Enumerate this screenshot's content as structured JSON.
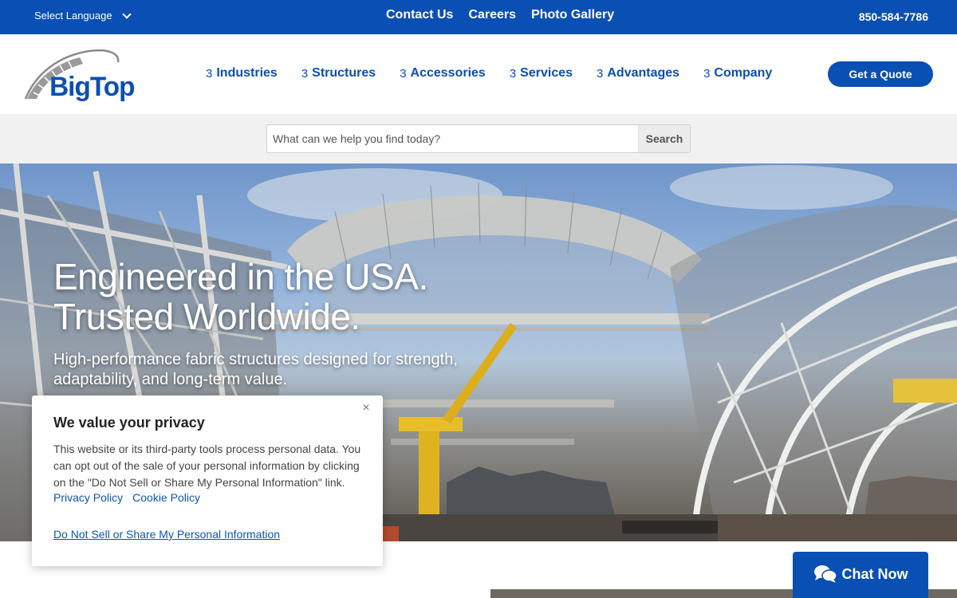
{
  "topbar": {
    "language_label": "Select Language",
    "links": [
      "Contact Us",
      "Careers",
      "Photo Gallery"
    ],
    "phone": "850-584-7786"
  },
  "header": {
    "logo_text": "BigTop",
    "nav_arrow": "3",
    "nav": [
      "Industries",
      "Structures",
      "Accessories",
      "Services",
      "Advantages",
      "Company"
    ],
    "quote_button": "Get a Quote"
  },
  "search": {
    "placeholder": "What can we help you find today?",
    "button": "Search"
  },
  "hero": {
    "title_line1": "Engineered in the USA.",
    "title_line2": "Trusted Worldwide.",
    "subtitle": "High-performance fabric structures designed for strength, adaptability, and long-term value."
  },
  "privacy": {
    "title": "We value your privacy",
    "body": "This website or its third-party tools process personal data. You can opt out of the sale of your personal information by clicking on the \"Do Not Sell or Share My Personal Information\" link.",
    "privacy_link": "Privacy Policy",
    "cookie_link": "Cookie Policy",
    "dns_link": "Do Not Sell or Share My Personal Information",
    "close_icon": "×"
  },
  "chat": {
    "label": "Chat Now"
  },
  "colors": {
    "brand_blue": "#0a4fb4",
    "link_blue": "#0a55b9"
  }
}
